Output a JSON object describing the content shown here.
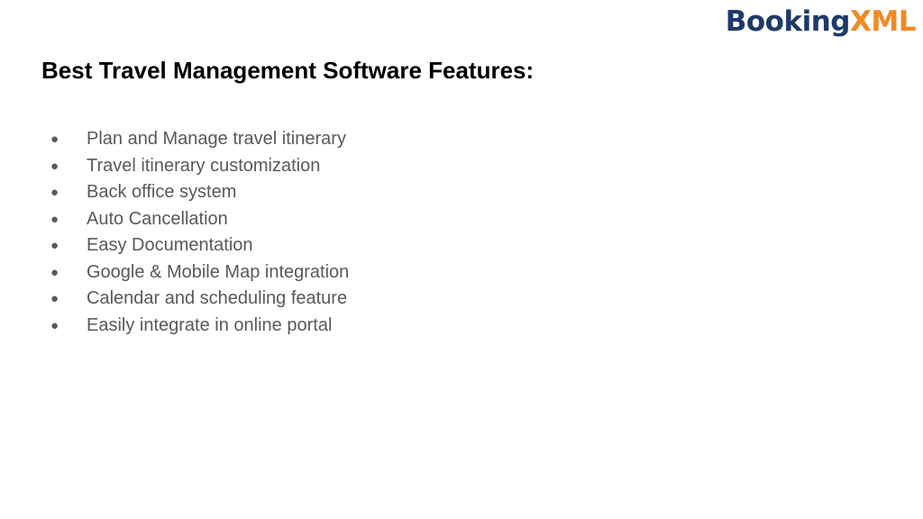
{
  "logo": {
    "part1": "Booking",
    "part2": "XML",
    "colors": {
      "primary": "#1e3a6b",
      "accent": "#f08a24"
    }
  },
  "title": "Best Travel Management Software Features:",
  "features": [
    "Plan and Manage travel itinerary",
    "Travel itinerary customization",
    "Back office system",
    "Auto Cancellation",
    "Easy Documentation",
    "Google & Mobile Map integration",
    "Calendar and scheduling feature",
    "Easily integrate in online portal"
  ],
  "bullet_symbol": "●"
}
